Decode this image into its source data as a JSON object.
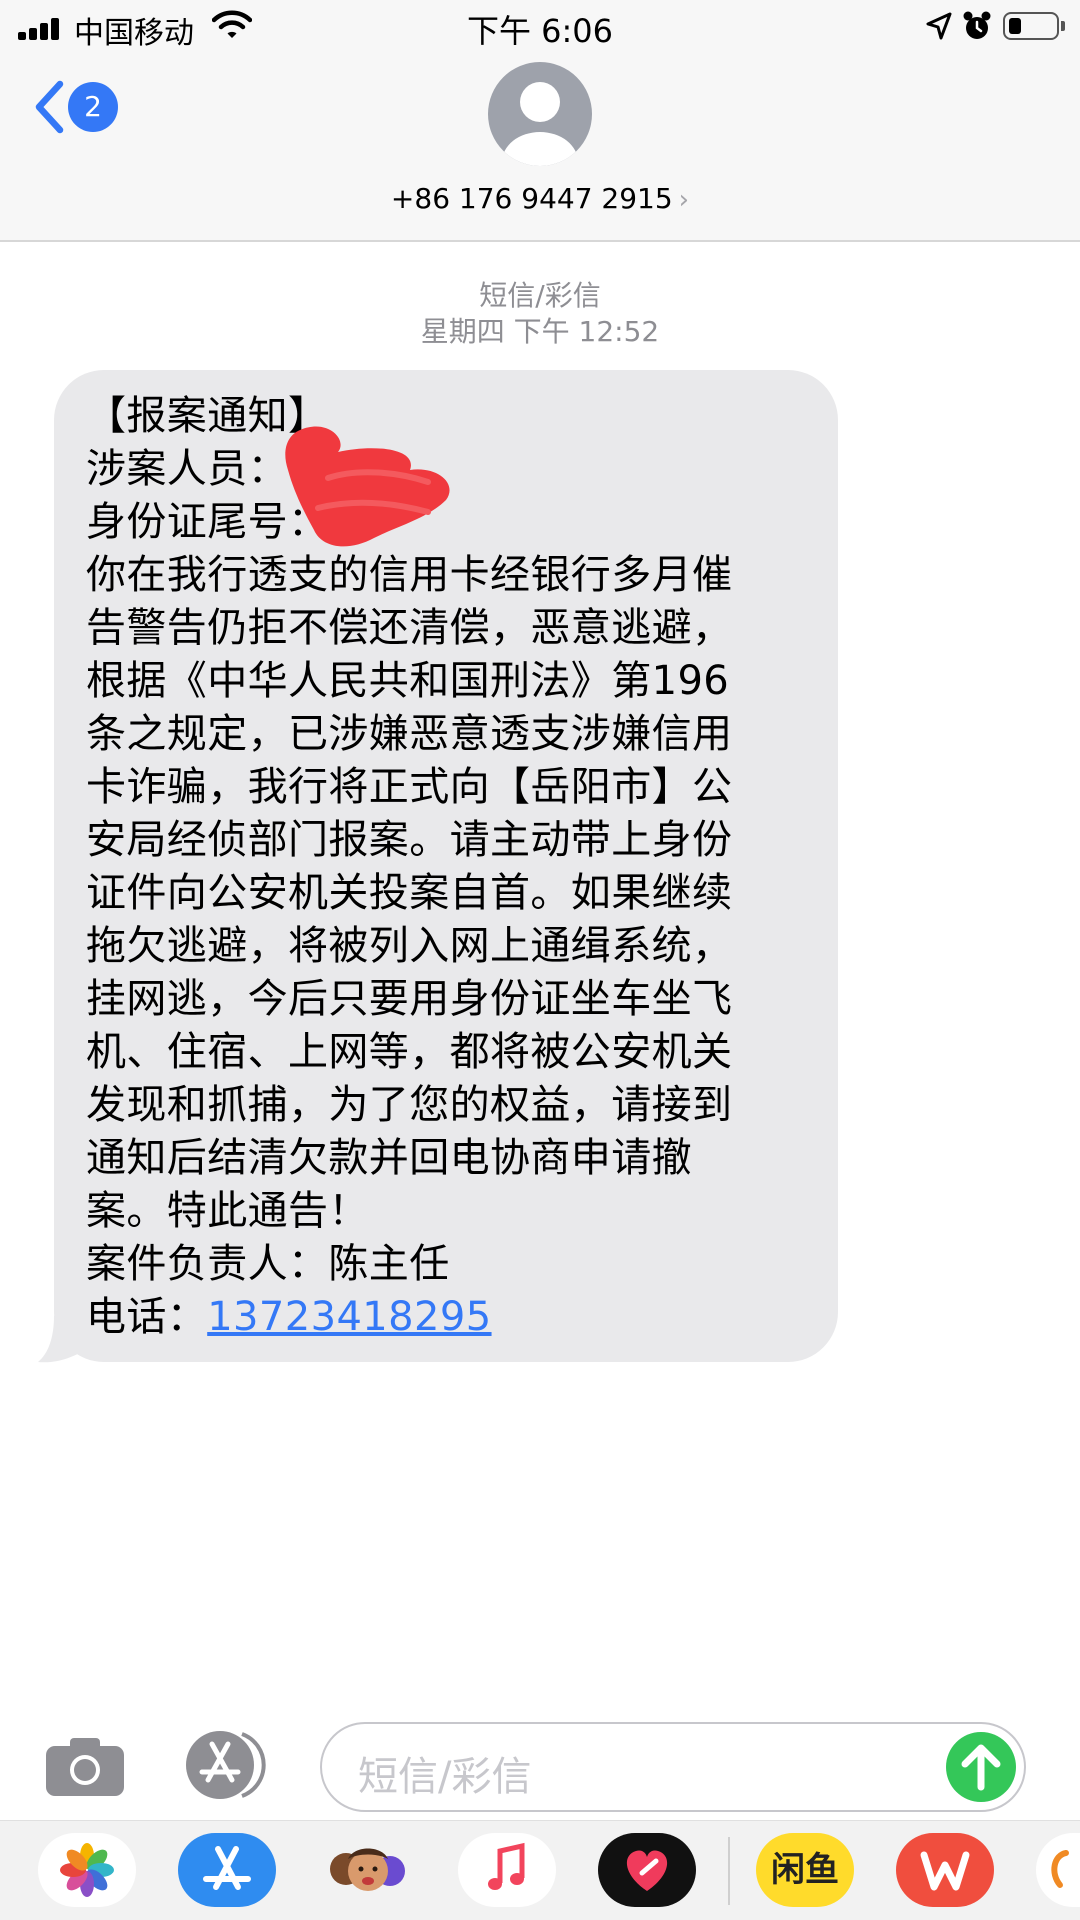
{
  "status_bar": {
    "carrier": "中国移动",
    "time": "下午 6:06",
    "icons": [
      "signal-bars-icon",
      "wifi-icon",
      "location-arrow-icon",
      "alarm-clock-icon",
      "battery-icon"
    ]
  },
  "header": {
    "back_badge": "2",
    "contact_number": "+86 176 9447 2915",
    "icons": [
      "back-chevron-icon",
      "contact-avatar-icon",
      "chevron-right-icon"
    ]
  },
  "conversation": {
    "message_type": "短信/彩信",
    "date": "星期四 下午 12:52"
  },
  "message": {
    "lines": [
      "【报案通知】",
      "涉案人员：",
      "身份证尾号：",
      "你在我行透支的信用卡经银行多月催",
      "告警告仍拒不偿还清偿，恶意逃避，",
      "根据《中华人民共和国刑法》第196",
      "条之规定，已涉嫌恶意透支涉嫌信用",
      "卡诈骗，我行将正式向【岳阳市】公",
      "安局经侦部门报案。请主动带上身份",
      "证件向公安机关投案自首。如果继续",
      "拖欠逃避，将被列入网上通缉系统，",
      "挂网逃，今后只要用身份证坐车坐飞",
      "机、住宿、上网等，都将被公安机关",
      "发现和抓捕，为了您的权益，请接到",
      "通知后结清欠款并回电协商申请撤",
      "案。特此通告！",
      "案件负责人：陈主任"
    ],
    "phone_label": "电话：",
    "phone_number": "13723418295",
    "redaction_color": "#f0393e"
  },
  "input_bar": {
    "placeholder": "短信/彩信",
    "icons": [
      "camera-icon",
      "app-store-icon",
      "send-arrow-icon"
    ],
    "send_color": "#34c759"
  },
  "app_drawer": {
    "apps": [
      {
        "name": "photos-app-icon"
      },
      {
        "name": "app-store-app-icon"
      },
      {
        "name": "memoji-app-icon"
      },
      {
        "name": "music-app-icon"
      },
      {
        "name": "heart-app-icon"
      },
      {
        "name": "xianyu-app-icon",
        "label": "闲鱼"
      },
      {
        "name": "wps-app-icon"
      },
      {
        "name": "partial-app-icon"
      }
    ]
  },
  "colors": {
    "accent_blue": "#3478f6",
    "bubble_gray": "#e9e9eb",
    "meta_gray": "#8e8e93"
  }
}
